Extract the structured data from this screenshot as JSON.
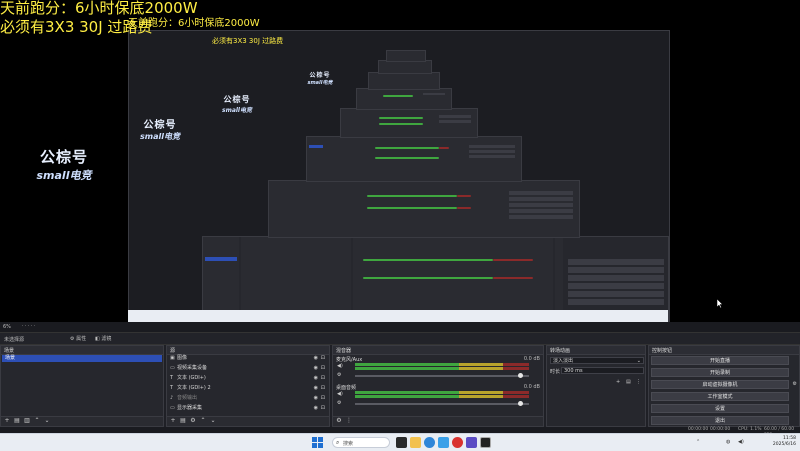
{
  "overlay": {
    "line1": "天前跑分：6小时保底2000W",
    "line2": "必须有3X3  30J 过路费",
    "line3": "天前跑分：6小时保底2000W",
    "line4": "必须有3X3  30J 过路费"
  },
  "brand": {
    "title": "公棕号",
    "subtitle": "small电竞"
  },
  "studio_toolbar": {
    "fps_label": "6%",
    "no_source": "未选择源",
    "properties": "属性",
    "filters": "滤镜"
  },
  "docks": {
    "scenes": {
      "title": "场景",
      "items": [
        "场景"
      ]
    },
    "sources": {
      "title": "源",
      "items": [
        {
          "icon": "image-icon",
          "label": "图像"
        },
        {
          "icon": "display-icon",
          "label": "视频采集设备"
        },
        {
          "icon": "text-icon",
          "label": "文本 (GDI+)"
        },
        {
          "icon": "text-icon",
          "label": "文本 (GDI+) 2"
        },
        {
          "icon": "audio-icon",
          "label": "音频输出"
        },
        {
          "icon": "monitor-icon",
          "label": "显示器采集"
        }
      ]
    },
    "mixer": {
      "title": "混音器",
      "channels": [
        {
          "name": "麦克风/Aux",
          "db": "0.0 dB",
          "level": 0.95
        },
        {
          "name": "桌面音频",
          "db": "0.0 dB",
          "level": 0.95
        }
      ]
    },
    "transitions": {
      "title": "转场动画",
      "type_value": "淡入淡出",
      "duration_label": "时长",
      "duration_value": "300 ms"
    },
    "controls": {
      "title": "控制按钮",
      "buttons": [
        "开始直播",
        "开始录制",
        "启动虚拟摄像机",
        "工作室模式",
        "设置",
        "退出"
      ]
    }
  },
  "statusbar": {
    "live": "00:00:00",
    "rec": "00:00:00",
    "cpu": "CPU: 1.1%",
    "fps": "60.00 / 60.00 FPS"
  },
  "taskbar": {
    "search_placeholder": "搜索",
    "time": "11:58",
    "date": "2025/6/16",
    "colors": {
      "start": "#1f6fd1"
    }
  }
}
